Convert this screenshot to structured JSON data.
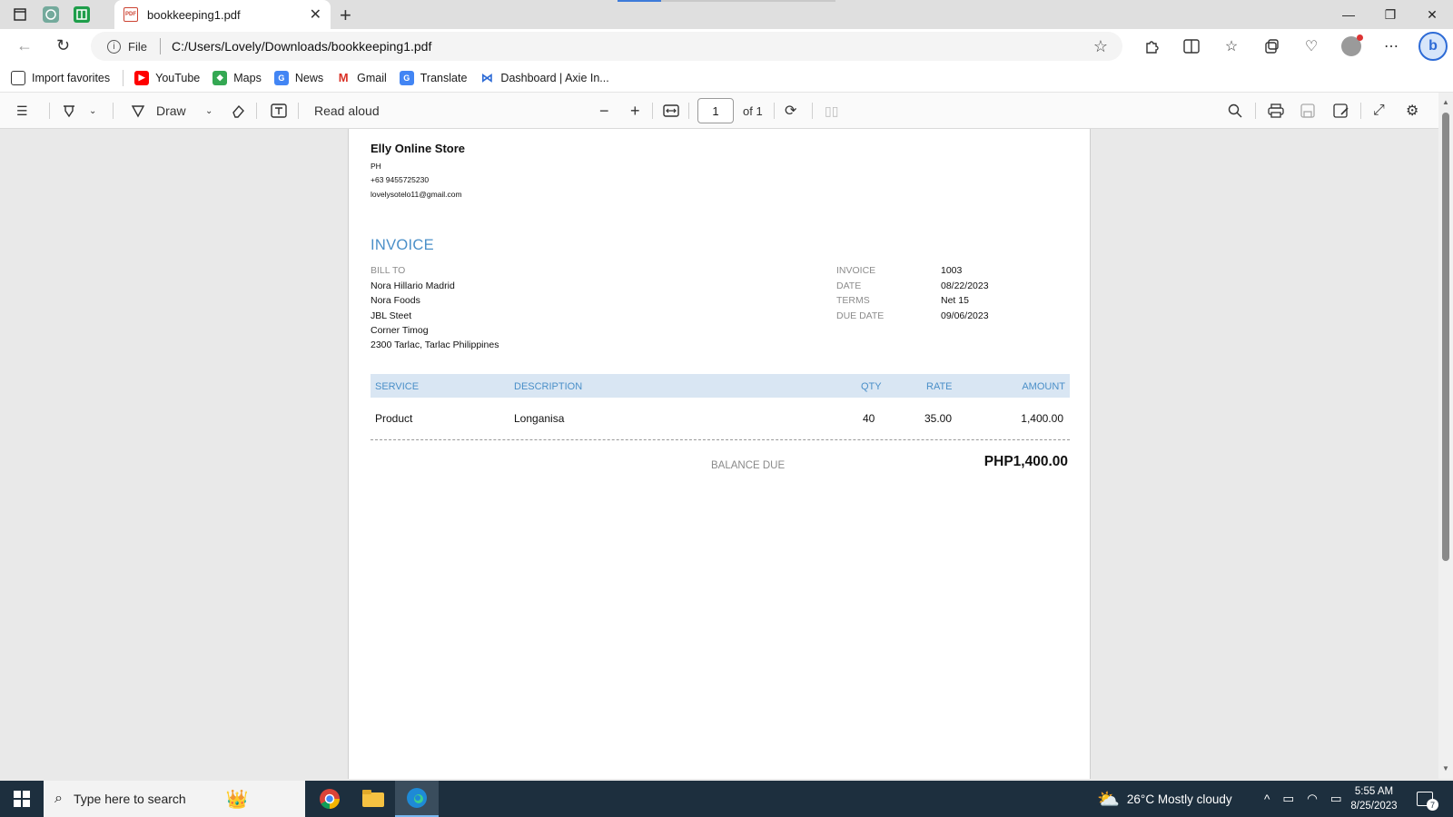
{
  "browser": {
    "tab_title": "bookkeeping1.pdf",
    "file_label": "File",
    "url": "C:/Users/Lovely/Downloads/bookkeeping1.pdf",
    "favorites": [
      {
        "label": "Import favorites",
        "icon": "import-icon"
      },
      {
        "label": "YouTube",
        "icon": "youtube-icon",
        "color": "#ff0000"
      },
      {
        "label": "Maps",
        "icon": "maps-icon"
      },
      {
        "label": "News",
        "icon": "news-icon"
      },
      {
        "label": "Gmail",
        "icon": "gmail-icon"
      },
      {
        "label": "Translate",
        "icon": "translate-icon"
      },
      {
        "label": "Dashboard | Axie In...",
        "icon": "axie-icon"
      }
    ]
  },
  "pdf_toolbar": {
    "draw_label": "Draw",
    "read_aloud_label": "Read aloud",
    "page_number": "1",
    "page_total": "of 1"
  },
  "invoice": {
    "store_name": "Elly Online Store",
    "country": "PH",
    "phone": "+63 9455725230",
    "email": "lovelysotelo11@gmail.com",
    "title": "INVOICE",
    "bill_to_label": "BILL TO",
    "bill_to": [
      "Nora Hillario Madrid",
      "Nora Foods",
      "JBL Steet",
      "Corner Timog",
      "2300 Tarlac, Tarlac Philippines"
    ],
    "meta": [
      {
        "label": "INVOICE",
        "value": "1003"
      },
      {
        "label": "DATE",
        "value": "08/22/2023"
      },
      {
        "label": "TERMS",
        "value": "Net 15"
      },
      {
        "label": "DUE DATE",
        "value": "09/06/2023"
      }
    ],
    "columns": {
      "service": "SERVICE",
      "description": "DESCRIPTION",
      "qty": "QTY",
      "rate": "RATE",
      "amount": "AMOUNT"
    },
    "rows": [
      {
        "service": "Product",
        "description": "Longanisa",
        "qty": "40",
        "rate": "35.00",
        "amount": "1,400.00"
      }
    ],
    "balance_due_label": "BALANCE DUE",
    "balance_due": "PHP1,400.00"
  },
  "taskbar": {
    "search_placeholder": "Type here to search",
    "weather": "26°C  Mostly cloudy",
    "time": "5:55 AM",
    "date": "8/25/2023",
    "notification_count": "7"
  }
}
